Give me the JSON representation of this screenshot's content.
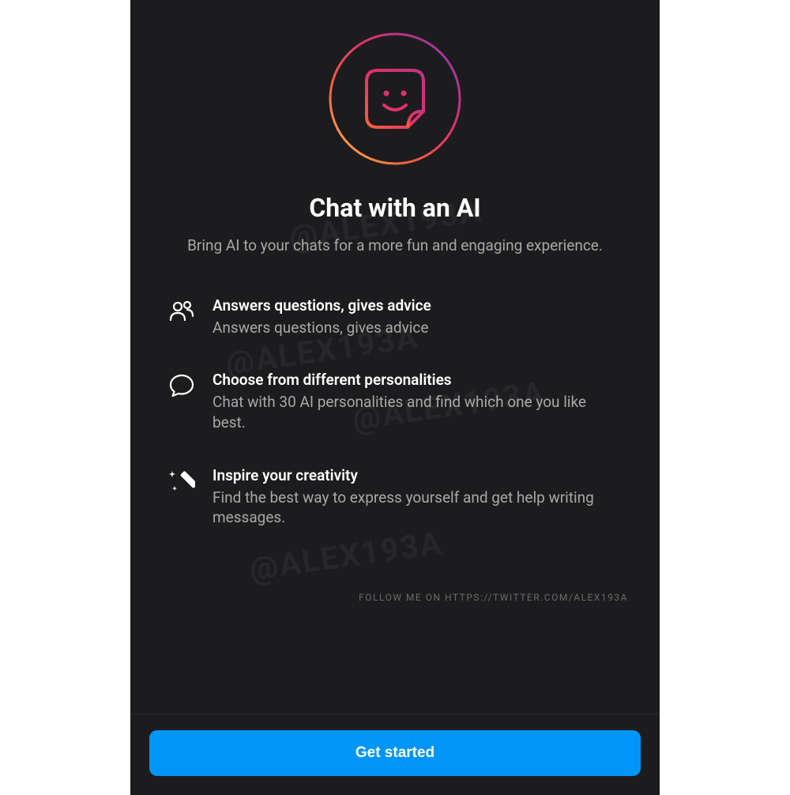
{
  "watermark": "@ALEX193A",
  "hero": {
    "title": "Chat with an AI",
    "subtitle": "Bring AI to your chats for a more fun and engaging experience."
  },
  "features": [
    {
      "icon": "people-icon",
      "title": "Answers questions, gives advice",
      "desc": "Answers questions, gives advice"
    },
    {
      "icon": "chat-bubble-icon",
      "title": "Choose from different personalities",
      "desc": "Chat with 30 AI personalities and find which one you like best."
    },
    {
      "icon": "magic-wand-icon",
      "title": "Inspire your creativity",
      "desc": "Find the best way to express yourself and get help writing messages."
    }
  ],
  "credit": "FOLLOW ME ON HTTPS://TWITTER.COM/ALEX193A",
  "cta": {
    "label": "Get started"
  },
  "colors": {
    "accent": "#0095f6",
    "background": "#1c1c1e",
    "text_primary": "#ffffff",
    "text_secondary": "#a8a8a8"
  }
}
